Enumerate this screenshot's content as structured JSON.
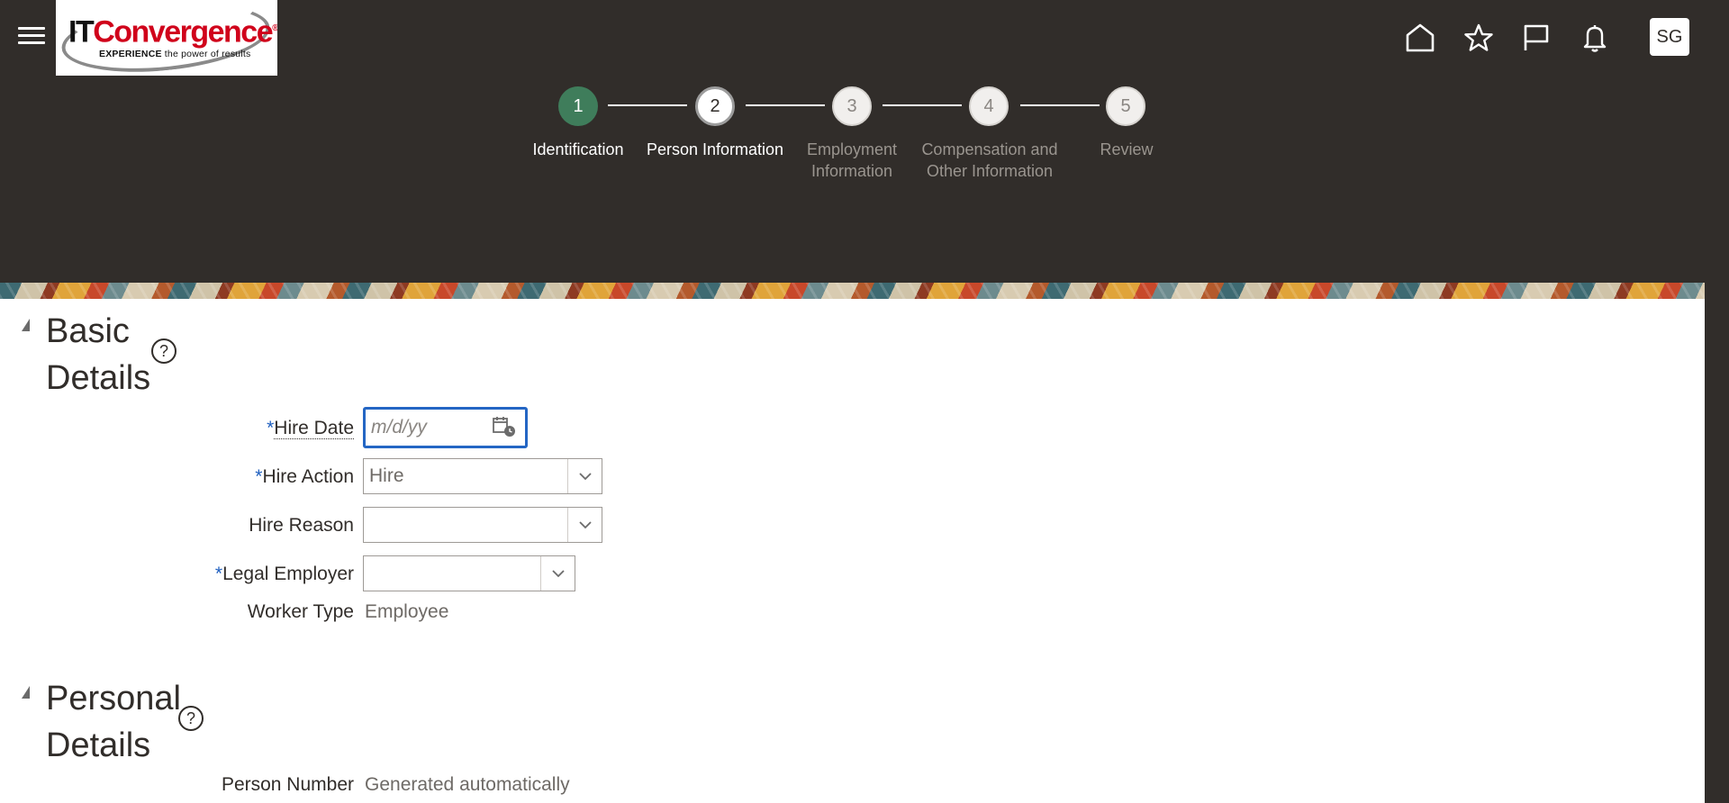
{
  "header": {
    "logo": {
      "brand_it": "IT",
      "brand_rest": "Convergence",
      "tagline_bold": "EXPERIENCE",
      "tagline_rest": " the power of results",
      "trademark": "®"
    },
    "avatar_initials": "SG",
    "icons": [
      "menu-icon",
      "home-icon",
      "favorites-icon",
      "flag-icon",
      "notifications-icon"
    ]
  },
  "train": {
    "steps": [
      {
        "number": "1",
        "label": "Identification",
        "state": "done"
      },
      {
        "number": "2",
        "label": "Person Information",
        "state": "current"
      },
      {
        "number": "3",
        "label": "Employment Information",
        "state": "future"
      },
      {
        "number": "4",
        "label": "Compensation and Other Information",
        "state": "future"
      },
      {
        "number": "5",
        "label": "Review",
        "state": "future"
      }
    ]
  },
  "basic_details": {
    "title": "Basic Details",
    "help": "?",
    "hire_date": {
      "label": "Hire Date",
      "required": "*",
      "placeholder": "m/d/yy"
    },
    "hire_action": {
      "label": "Hire Action",
      "required": "*",
      "value": "Hire"
    },
    "hire_reason": {
      "label": "Hire Reason",
      "value": ""
    },
    "legal_employer": {
      "label": "Legal Employer",
      "required": "*",
      "value": ""
    },
    "worker_type": {
      "label": "Worker Type",
      "value": "Employee"
    }
  },
  "personal_details": {
    "title": "Personal Details",
    "help": "?",
    "person_number": {
      "label": "Person Number",
      "value": "Generated automatically"
    }
  },
  "colors": {
    "header_bg": "#312d2a",
    "done_step": "#3f7d5b",
    "focus_border": "#2466c4",
    "required_star": "#1f5fbf"
  }
}
